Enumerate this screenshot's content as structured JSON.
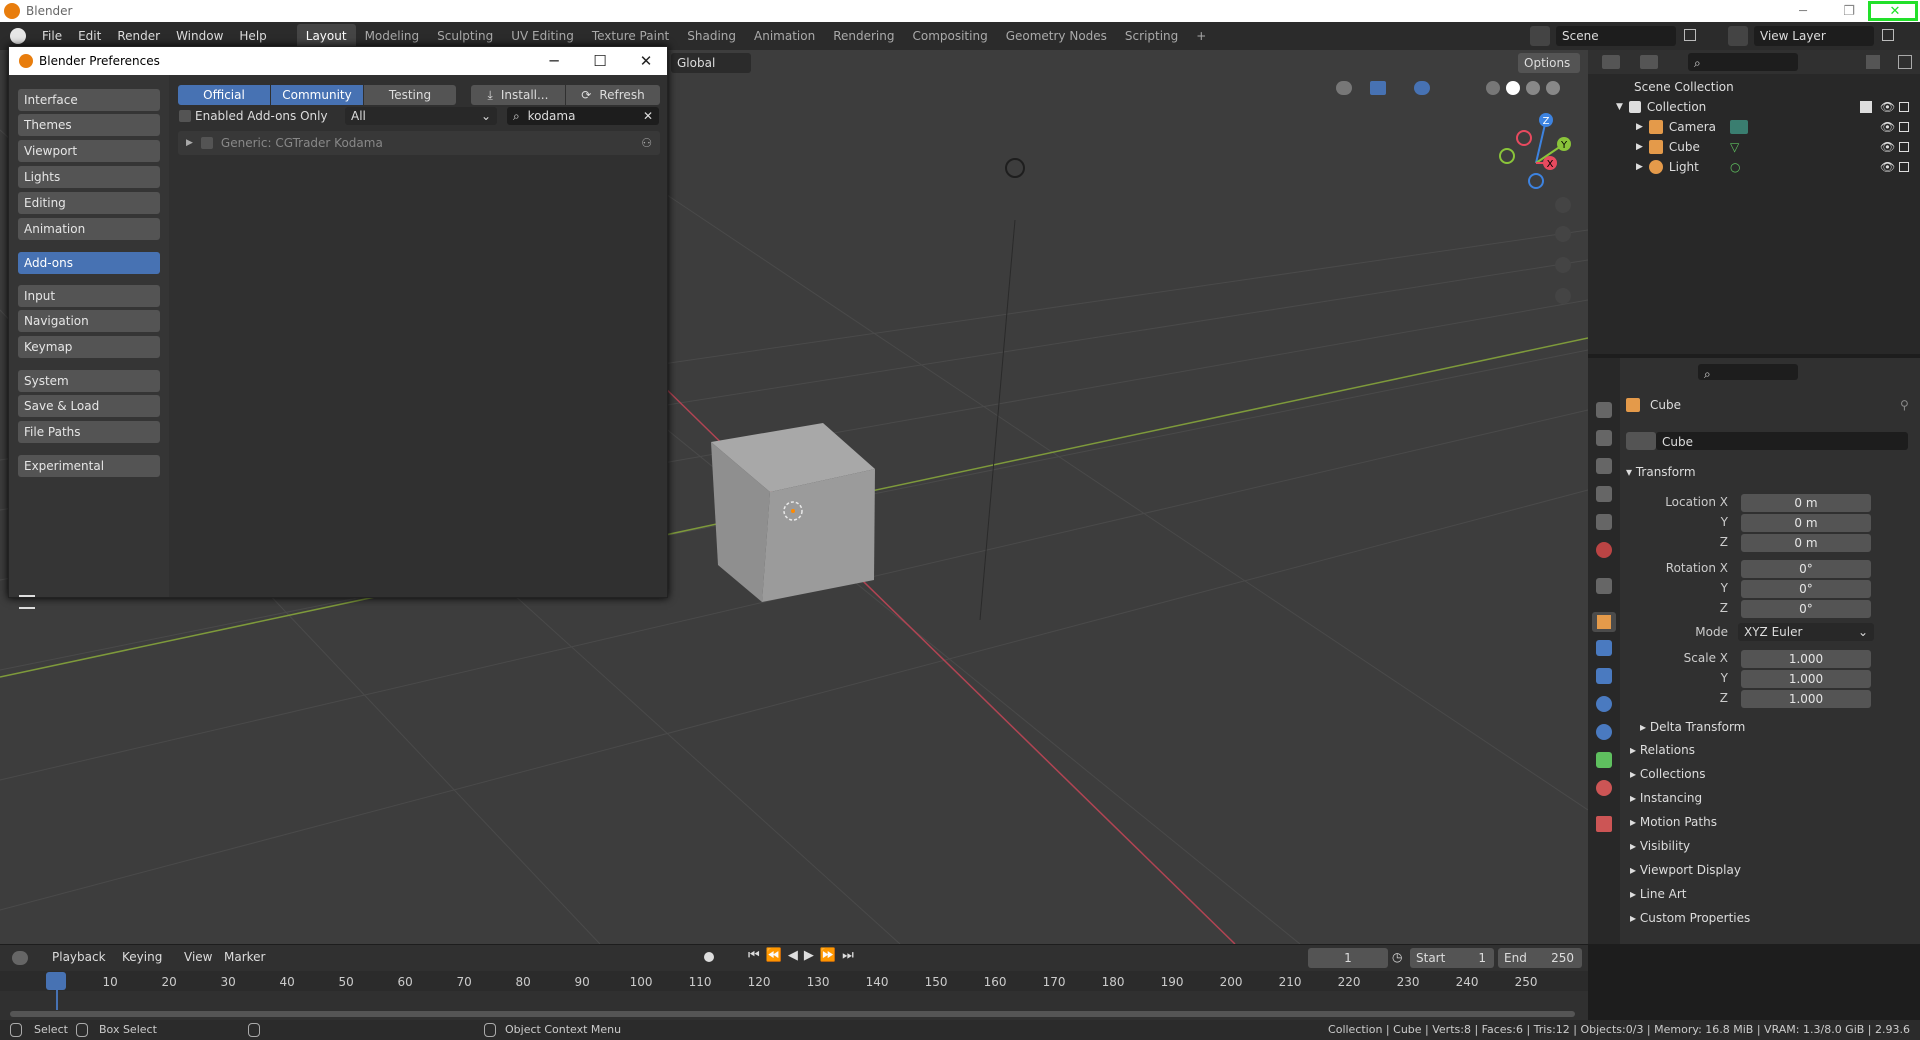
{
  "os_window": {
    "title": "Blender",
    "minimize": "─",
    "restore": "❐",
    "close": "✕"
  },
  "menu": {
    "items": [
      "File",
      "Edit",
      "Render",
      "Window",
      "Help"
    ]
  },
  "workspaces": [
    "Layout",
    "Modeling",
    "Sculpting",
    "UV Editing",
    "Texture Paint",
    "Shading",
    "Animation",
    "Rendering",
    "Compositing",
    "Geometry Nodes",
    "Scripting"
  ],
  "add_workspace": "+",
  "scene": {
    "name": "Scene",
    "view_layer": "View Layer"
  },
  "viewport_header": {
    "orientation": "Global",
    "options": "Options"
  },
  "prefs": {
    "title": "Blender Preferences",
    "sidebar": [
      "Interface",
      "Themes",
      "Viewport",
      "Lights",
      "Editing",
      "Animation",
      "Add-ons",
      "Input",
      "Navigation",
      "Keymap",
      "System",
      "Save & Load",
      "File Paths",
      "Experimental"
    ],
    "active": "Add-ons",
    "tabs": [
      "Official",
      "Community",
      "Testing"
    ],
    "install": "Install...",
    "refresh": "Refresh",
    "enabled_only": "Enabled Add-ons Only",
    "category": "All",
    "search_value": "kodama",
    "addon_row": "Generic: CGTrader Kodama"
  },
  "outliner": {
    "root": "Scene Collection",
    "collection": "Collection",
    "items": [
      "Camera",
      "Cube",
      "Light"
    ]
  },
  "properties": {
    "object_name": "Cube",
    "datablock": "Cube",
    "transform": "Transform",
    "location_x_label": "Location X",
    "location_x": "0 m",
    "location_y_label": "Y",
    "location_y": "0 m",
    "location_z_label": "Z",
    "location_z": "0 m",
    "rotation_x_label": "Rotation X",
    "rotation_x": "0°",
    "rotation_y_label": "Y",
    "rotation_y": "0°",
    "rotation_z_label": "Z",
    "rotation_z": "0°",
    "mode_label": "Mode",
    "mode": "XYZ Euler",
    "scale_x_label": "Scale X",
    "scale_x": "1.000",
    "scale_y_label": "Y",
    "scale_y": "1.000",
    "scale_z_label": "Z",
    "scale_z": "1.000",
    "delta": "Delta Transform",
    "panels": [
      "Relations",
      "Collections",
      "Instancing",
      "Motion Paths",
      "Visibility",
      "Viewport Display",
      "Line Art",
      "Custom Properties"
    ]
  },
  "timeline": {
    "menus": [
      "Playback",
      "Keying",
      "View",
      "Marker"
    ],
    "current_frame": "1",
    "start_label": "Start",
    "start": "1",
    "end_label": "End",
    "end": "250",
    "ticks": [
      "1",
      "10",
      "20",
      "30",
      "40",
      "50",
      "60",
      "70",
      "80",
      "90",
      "100",
      "110",
      "120",
      "130",
      "140",
      "150",
      "160",
      "170",
      "180",
      "190",
      "200",
      "210",
      "220",
      "230",
      "240",
      "250"
    ]
  },
  "status": {
    "select": "Select",
    "box_select": "Box Select",
    "context_menu": "Object Context Menu",
    "info": "Collection | Cube | Verts:8 | Faces:6 | Tris:12 | Objects:0/3 | Memory: 16.8 MiB | VRAM: 1.3/8.0 GiB | 2.93.6"
  },
  "gizmo": {
    "x": "X",
    "y": "Y",
    "z": "Z"
  },
  "colors": {
    "accent": "#4772b3",
    "annotation": "#22e02a",
    "x_axis": "#e84a5f",
    "y_axis": "#8ac43a",
    "z_axis": "#3d83e0"
  }
}
